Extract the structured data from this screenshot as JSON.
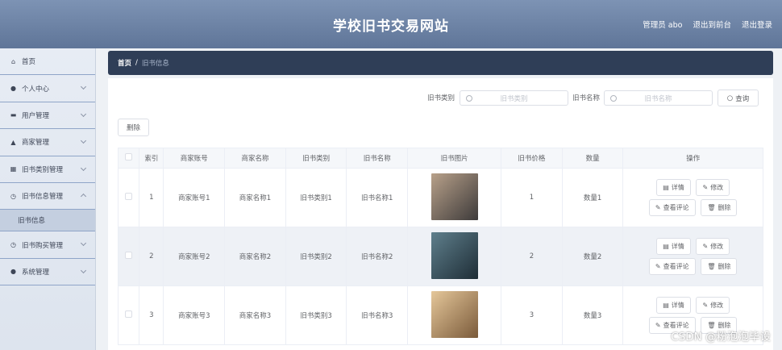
{
  "header": {
    "title": "学校旧书交易网站",
    "user_label": "管理员 abo",
    "to_front": "退出到前台",
    "logout": "退出登录"
  },
  "sidebar": {
    "items": [
      {
        "label": "首页",
        "icon": "home-icon"
      },
      {
        "label": "个人中心",
        "icon": "user-icon"
      },
      {
        "label": "用户管理",
        "icon": "users-icon"
      },
      {
        "label": "商家管理",
        "icon": "store-icon"
      },
      {
        "label": "旧书类别管理",
        "icon": "category-icon"
      },
      {
        "label": "旧书信息管理",
        "icon": "clock-icon"
      },
      {
        "label": "旧书信息",
        "icon": ""
      },
      {
        "label": "旧书购买管理",
        "icon": "clock-icon"
      },
      {
        "label": "系统管理",
        "icon": "user-icon"
      }
    ]
  },
  "breadcrumb": {
    "home": "首页",
    "separator": "/",
    "current": "旧书信息"
  },
  "search": {
    "category_label": "旧书类别",
    "category_placeholder": "旧书类别",
    "name_label": "旧书名称",
    "name_placeholder": "旧书名称",
    "query_button": "查询"
  },
  "toolbar": {
    "delete_label": "删除"
  },
  "table": {
    "headers": [
      "",
      "索引",
      "商家账号",
      "商家名称",
      "旧书类别",
      "旧书名称",
      "旧书图片",
      "旧书价格",
      "数量",
      "操作"
    ],
    "rows": [
      {
        "index": "1",
        "account": "商家账号1",
        "name": "商家名称1",
        "category": "旧书类别1",
        "book_name": "旧书名称1",
        "price": "1",
        "quantity": "数量1",
        "img_colors": [
          "#b8a18a",
          "#3d3a3a"
        ]
      },
      {
        "index": "2",
        "account": "商家账号2",
        "name": "商家名称2",
        "category": "旧书类别2",
        "book_name": "旧书名称2",
        "price": "2",
        "quantity": "数量2",
        "img_colors": [
          "#5f7f8c",
          "#1e2d36"
        ]
      },
      {
        "index": "3",
        "account": "商家账号3",
        "name": "商家名称3",
        "category": "旧书类别3",
        "book_name": "旧书名称3",
        "price": "3",
        "quantity": "数量3",
        "img_colors": [
          "#e5c79a",
          "#7a5a3a"
        ]
      }
    ],
    "actions": {
      "detail": "详情",
      "edit": "修改",
      "view_comments": "查看评论",
      "delete": "删除"
    }
  },
  "watermark": "CSDN @粉泡泡毕设"
}
